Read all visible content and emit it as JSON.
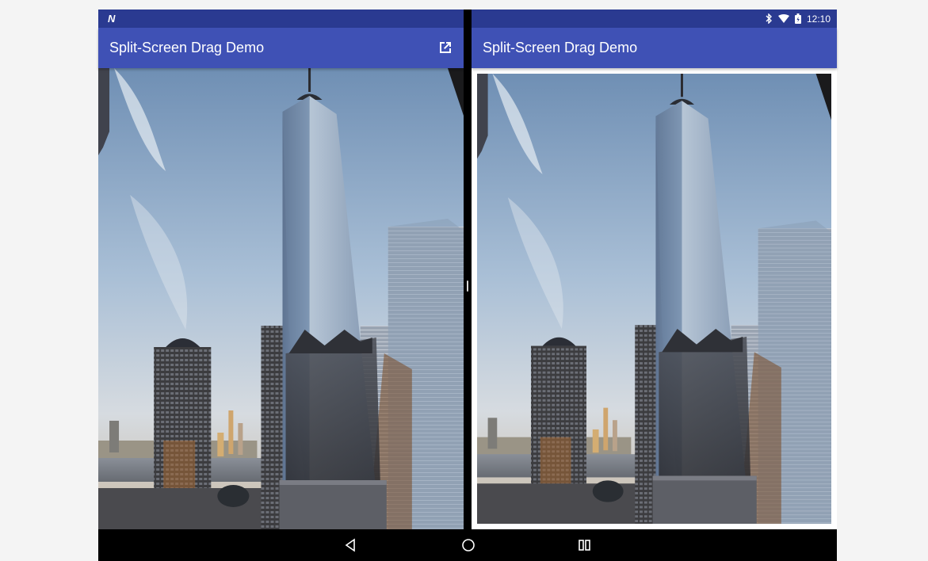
{
  "status_bar": {
    "left_icon": "n-notification-icon",
    "right_icons": [
      "bluetooth-icon",
      "wifi-icon",
      "battery-icon"
    ],
    "time": "12:10"
  },
  "left_pane": {
    "title": "Split-Screen Drag Demo",
    "action_icon": "open-in-new-icon"
  },
  "right_pane": {
    "title": "Split-Screen Drag Demo"
  },
  "nav_bar": {
    "icons": [
      "back-icon",
      "home-icon",
      "recents-icon"
    ]
  },
  "colors": {
    "app_bar": "#3f51b5",
    "status_bar": "#2a3a91",
    "nav_bar": "#000000"
  }
}
